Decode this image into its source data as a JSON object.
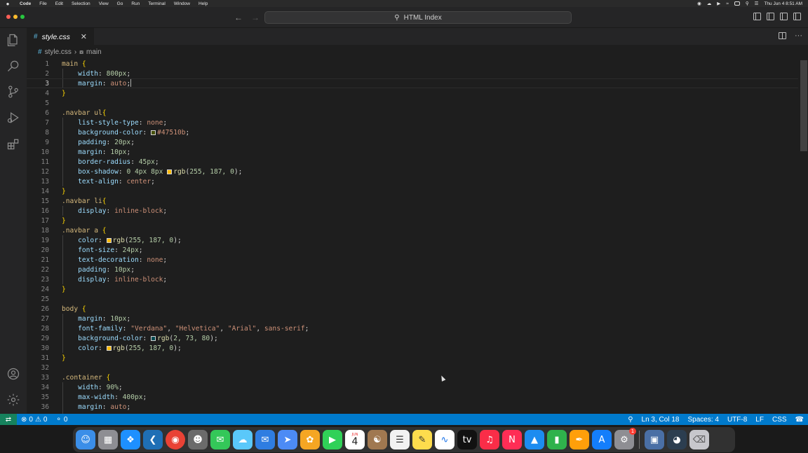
{
  "menubar": {
    "app_name": "Code",
    "items": [
      "File",
      "Edit",
      "Selection",
      "View",
      "Go",
      "Run",
      "Terminal",
      "Window",
      "Help"
    ],
    "clock": "Thu Jun 4  8:51 AM"
  },
  "titlebar": {
    "search_text": "HTML Index"
  },
  "tab": {
    "filename": "style.css"
  },
  "breadcrumbs": {
    "file": "style.css",
    "symbol": "main"
  },
  "editor": {
    "current_line": 3,
    "lines": [
      "1",
      "2",
      "3",
      "4",
      "5",
      "6",
      "7",
      "8",
      "9",
      "10",
      "11",
      "12",
      "13",
      "14",
      "15",
      "16",
      "17",
      "18",
      "19",
      "20",
      "21",
      "22",
      "23",
      "24",
      "25",
      "26",
      "27",
      "28",
      "29",
      "30",
      "31",
      "32",
      "33",
      "34",
      "35",
      "36"
    ],
    "code": {
      "l1_sel": "main",
      "l2_prop": "width",
      "l2_val": "800px",
      "l3_prop": "margin",
      "l3_val": "auto",
      "l6_sel": ".navbar ul",
      "l7_prop": "list-style-type",
      "l7_val": "none",
      "l8_prop": "background-color",
      "l8_val": "#47510b",
      "l8_color": "#47510b",
      "l9_prop": "padding",
      "l9_val": "20px",
      "l10_prop": "margin",
      "l10_val": "10px",
      "l11_prop": "border-radius",
      "l11_val": "45px",
      "l12_prop": "box-shadow",
      "l12_val": "0 4px 8px",
      "l12_fn": "rgb",
      "l12_args": "255, 187, 0",
      "l12_color": "#ffbb00",
      "l13_prop": "text-align",
      "l13_val": "center",
      "l15_sel": ".navbar li",
      "l16_prop": "display",
      "l16_val": "inline-block",
      "l18_sel": ".navbar a",
      "l19_prop": "color",
      "l19_fn": "rgb",
      "l19_args": "255, 187, 0",
      "l19_color": "#ffbb00",
      "l20_prop": "font-size",
      "l20_val": "24px",
      "l21_prop": "text-decoration",
      "l21_val": "none",
      "l22_prop": "padding",
      "l22_val": "10px",
      "l23_prop": "display",
      "l23_val": "inline-block",
      "l26_sel": "body",
      "l27_prop": "margin",
      "l27_val": "10px",
      "l28_prop": "font-family",
      "l28_s1": "\"Verdana\"",
      "l28_s2": "\"Helvetica\"",
      "l28_s3": "\"Arial\"",
      "l28_val": "sans-serif",
      "l29_prop": "background-color",
      "l29_fn": "rgb",
      "l29_args": "2, 73, 80",
      "l29_color": "#024950",
      "l30_prop": "color",
      "l30_fn": "rgb",
      "l30_args": "255, 187, 0",
      "l30_color": "#ffbb00",
      "l33_sel": ".container",
      "l34_prop": "width",
      "l34_val": "90%",
      "l35_prop": "max-width",
      "l35_val": "400px",
      "l36_prop": "margin",
      "l36_val": "auto"
    }
  },
  "statusbar": {
    "errors": "0",
    "warnings": "0",
    "ports": "0",
    "position": "Ln 3, Col 18",
    "spaces": "Spaces: 4",
    "encoding": "UTF-8",
    "eol": "LF",
    "language": "CSS"
  },
  "dock": {
    "calendar_month": "JUN",
    "calendar_day": "4",
    "settings_badge": "1"
  }
}
